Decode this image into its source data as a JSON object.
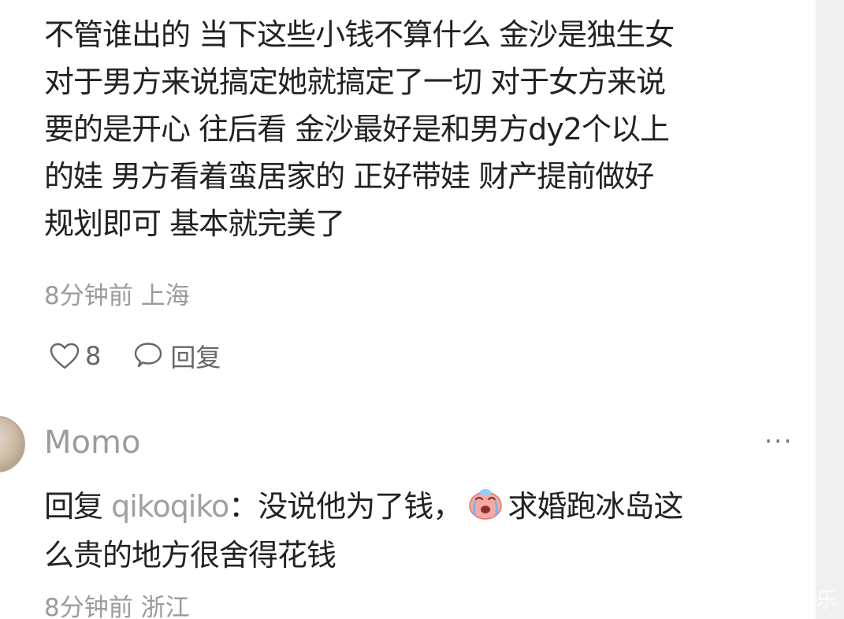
{
  "comment": {
    "text_lines": [
      "不管谁出的 当下这些小钱不算什么 金沙是独生女",
      "对于男方来说搞定她就搞定了一切 对于女方来说",
      "要的是开心 往后看 金沙最好是和男方dy2个以上",
      "的娃 男方看着蛮居家的 正好带娃 财产提前做好",
      "规划即可 基本就完美了"
    ],
    "meta": "8分钟前 上海",
    "like_count": "8",
    "reply_label": "回复"
  },
  "reply_comment": {
    "username": "Momo",
    "more_label": "···",
    "reply_prefix": "回复",
    "mention": "qikoqiko",
    "separator": "：",
    "text_part1": "没说他为了钱，",
    "emoji_icon": "crying-face-emoji",
    "text_part2": "求婚跑冰岛这",
    "text_line2": "么贵的地方很舍得花钱",
    "meta": "8分钟前 浙江"
  },
  "watermark": "乐",
  "colors": {
    "text": "#222222",
    "muted": "#9b9b9b",
    "gutter": "#f0f0f0"
  }
}
